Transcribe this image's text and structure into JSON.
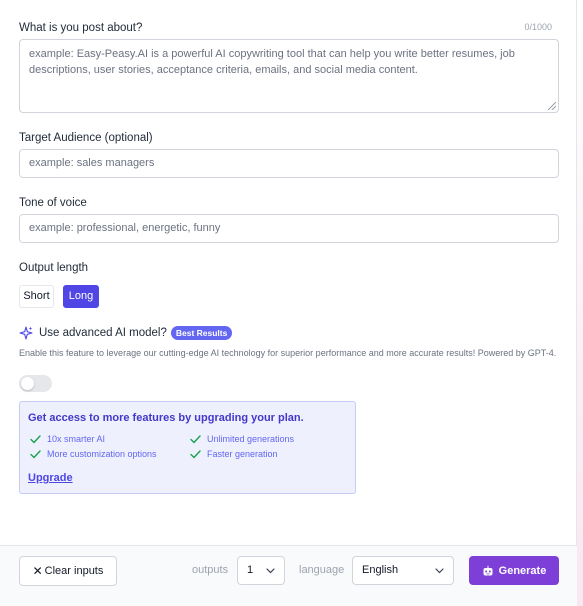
{
  "post": {
    "label": "What is you post about?",
    "counter": "0/1000",
    "placeholder": "example: Easy-Peasy.AI is a powerful AI copywriting tool that can help you write better resumes, job descriptions, user stories, acceptance criteria, emails, and social media content."
  },
  "audience": {
    "label": "Target Audience (optional)",
    "placeholder": "example: sales managers"
  },
  "tone": {
    "label": "Tone of voice",
    "placeholder": "example: professional, energetic, funny"
  },
  "output_length": {
    "label": "Output length",
    "options": [
      "Short",
      "Long"
    ],
    "selected": "Long"
  },
  "advanced": {
    "label": "Use advanced AI model?",
    "badge": "Best Results",
    "description": "Enable this feature to leverage our cutting-edge AI technology for superior performance and more accurate results! Powered by GPT-4.",
    "enabled": false
  },
  "upgrade": {
    "title": "Get access to more features by upgrading your plan.",
    "features": [
      "10x smarter AI",
      "Unlimited generations",
      "More customization options",
      "Faster generation"
    ],
    "link": "Upgrade"
  },
  "footer": {
    "clear_label": "Clear inputs",
    "outputs_label": "outputs",
    "outputs_value": "1",
    "language_label": "language",
    "language_value": "English",
    "generate_label": "Generate"
  },
  "colors": {
    "accent": "#4f46e5",
    "generate": "#7e3fd8",
    "badge": "#6366f1",
    "check": "#16a34a"
  },
  "icons": {
    "advanced": "sparkle-icon",
    "feature": "check-icon",
    "clear": "close-icon",
    "select": "chevron-down-icon",
    "generate": "robot-icon"
  }
}
